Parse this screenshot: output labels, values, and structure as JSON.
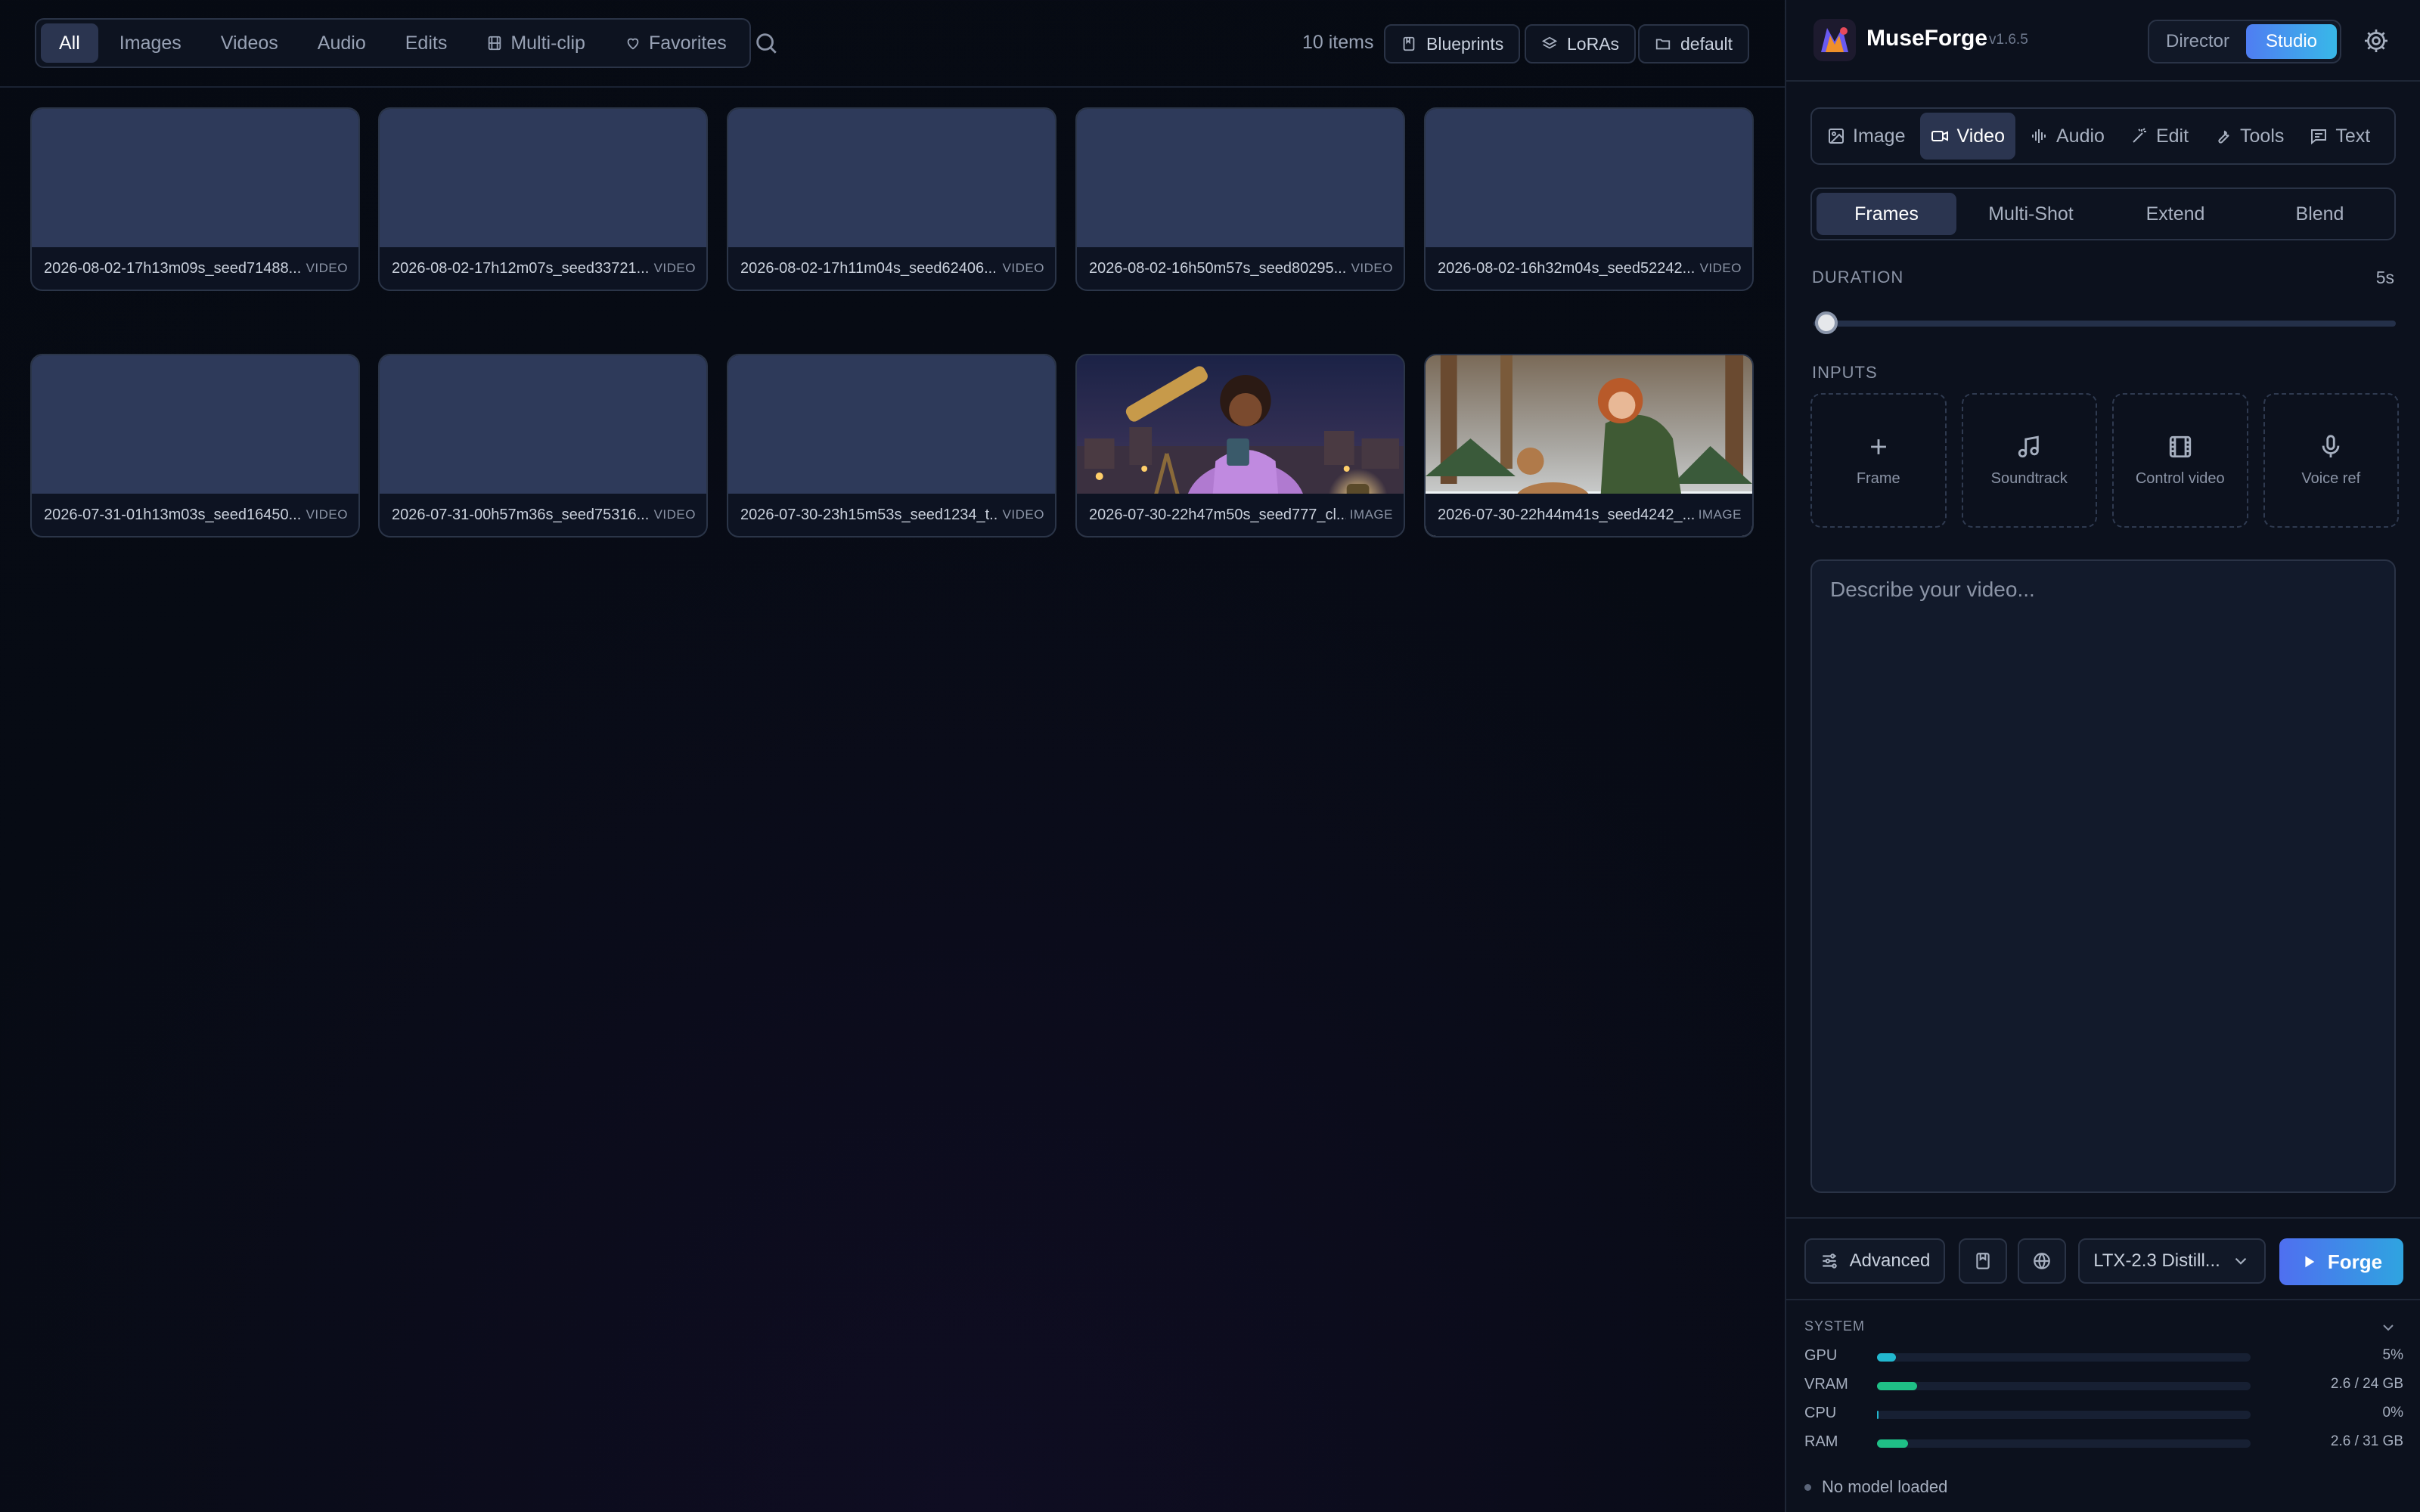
{
  "gallery": {
    "filters": [
      {
        "label": "All",
        "active": true,
        "icon": ""
      },
      {
        "label": "Images",
        "active": false,
        "icon": ""
      },
      {
        "label": "Videos",
        "active": false,
        "icon": ""
      },
      {
        "label": "Audio",
        "active": false,
        "icon": ""
      },
      {
        "label": "Edits",
        "active": false,
        "icon": ""
      },
      {
        "label": "Multi-clip",
        "active": false,
        "icon": "film-icon"
      },
      {
        "label": "Favorites",
        "active": false,
        "icon": "heart-icon"
      }
    ],
    "items_count": "10 items",
    "toolbar": {
      "blueprints": "Blueprints",
      "loras": "LoRAs",
      "folder": "default"
    },
    "items": [
      {
        "name": "2026-08-02-17h13m09s_seed71488...",
        "kind": "VIDEO"
      },
      {
        "name": "2026-08-02-17h12m07s_seed33721...",
        "kind": "VIDEO"
      },
      {
        "name": "2026-08-02-17h11m04s_seed62406...",
        "kind": "VIDEO"
      },
      {
        "name": "2026-08-02-16h50m57s_seed80295...",
        "kind": "VIDEO"
      },
      {
        "name": "2026-08-02-16h32m04s_seed52242...",
        "kind": "VIDEO"
      },
      {
        "name": "2026-07-31-01h13m03s_seed16450...",
        "kind": "VIDEO"
      },
      {
        "name": "2026-07-31-00h57m36s_seed75316...",
        "kind": "VIDEO"
      },
      {
        "name": "2026-07-30-23h15m53s_seed1234_t...",
        "kind": "VIDEO"
      },
      {
        "name": "2026-07-30-22h47m50s_seed777_cl...",
        "kind": "IMAGE",
        "thumb": "telescope-scene"
      },
      {
        "name": "2026-07-30-22h44m41s_seed4242_...",
        "kind": "IMAGE",
        "thumb": "forest-deer-scene"
      }
    ]
  },
  "panel": {
    "app_name": "MuseForge",
    "version": "v1.6.5",
    "modes": [
      {
        "label": "Director",
        "active": false
      },
      {
        "label": "Studio",
        "active": true
      }
    ],
    "type_tabs": [
      {
        "label": "Image",
        "icon": "image-icon",
        "active": false
      },
      {
        "label": "Video",
        "icon": "video-icon",
        "active": true
      },
      {
        "label": "Audio",
        "icon": "waveform-icon",
        "active": false
      },
      {
        "label": "Edit",
        "icon": "wand-icon",
        "active": false
      },
      {
        "label": "Tools",
        "icon": "wrench-icon",
        "active": false
      },
      {
        "label": "Text",
        "icon": "message-icon",
        "active": false
      }
    ],
    "sub_tabs": [
      {
        "label": "Frames",
        "active": true
      },
      {
        "label": "Multi-Shot",
        "active": false
      },
      {
        "label": "Extend",
        "active": false
      },
      {
        "label": "Blend",
        "active": false
      }
    ],
    "duration": {
      "label": "DURATION",
      "value": "5s",
      "fraction": 0.0
    },
    "inputs": {
      "label": "INPUTS",
      "tiles": [
        {
          "label": "Frame",
          "icon": "plus-icon"
        },
        {
          "label": "Soundtrack",
          "icon": "music-icon"
        },
        {
          "label": "Control video",
          "icon": "film-icon"
        },
        {
          "label": "Voice ref",
          "icon": "microphone-icon"
        }
      ]
    },
    "prompt_placeholder": "Describe your video...",
    "actions": {
      "advanced": "Advanced",
      "model": "LTX-2.3 Distill...",
      "forge": "Forge"
    },
    "system": {
      "title": "SYSTEM",
      "metrics": [
        {
          "name": "GPU",
          "value": "5%",
          "fraction": 0.05,
          "color": "#22b8cf"
        },
        {
          "name": "VRAM",
          "value": "2.6 / 24 GB",
          "fraction": 0.108,
          "color": "#1fbf86"
        },
        {
          "name": "CPU",
          "value": "0%",
          "fraction": 0.0,
          "color": "#22b8cf"
        },
        {
          "name": "RAM",
          "value": "2.6 / 31 GB",
          "fraction": 0.084,
          "color": "#1fbf86"
        }
      ],
      "status": "No model loaded"
    }
  }
}
